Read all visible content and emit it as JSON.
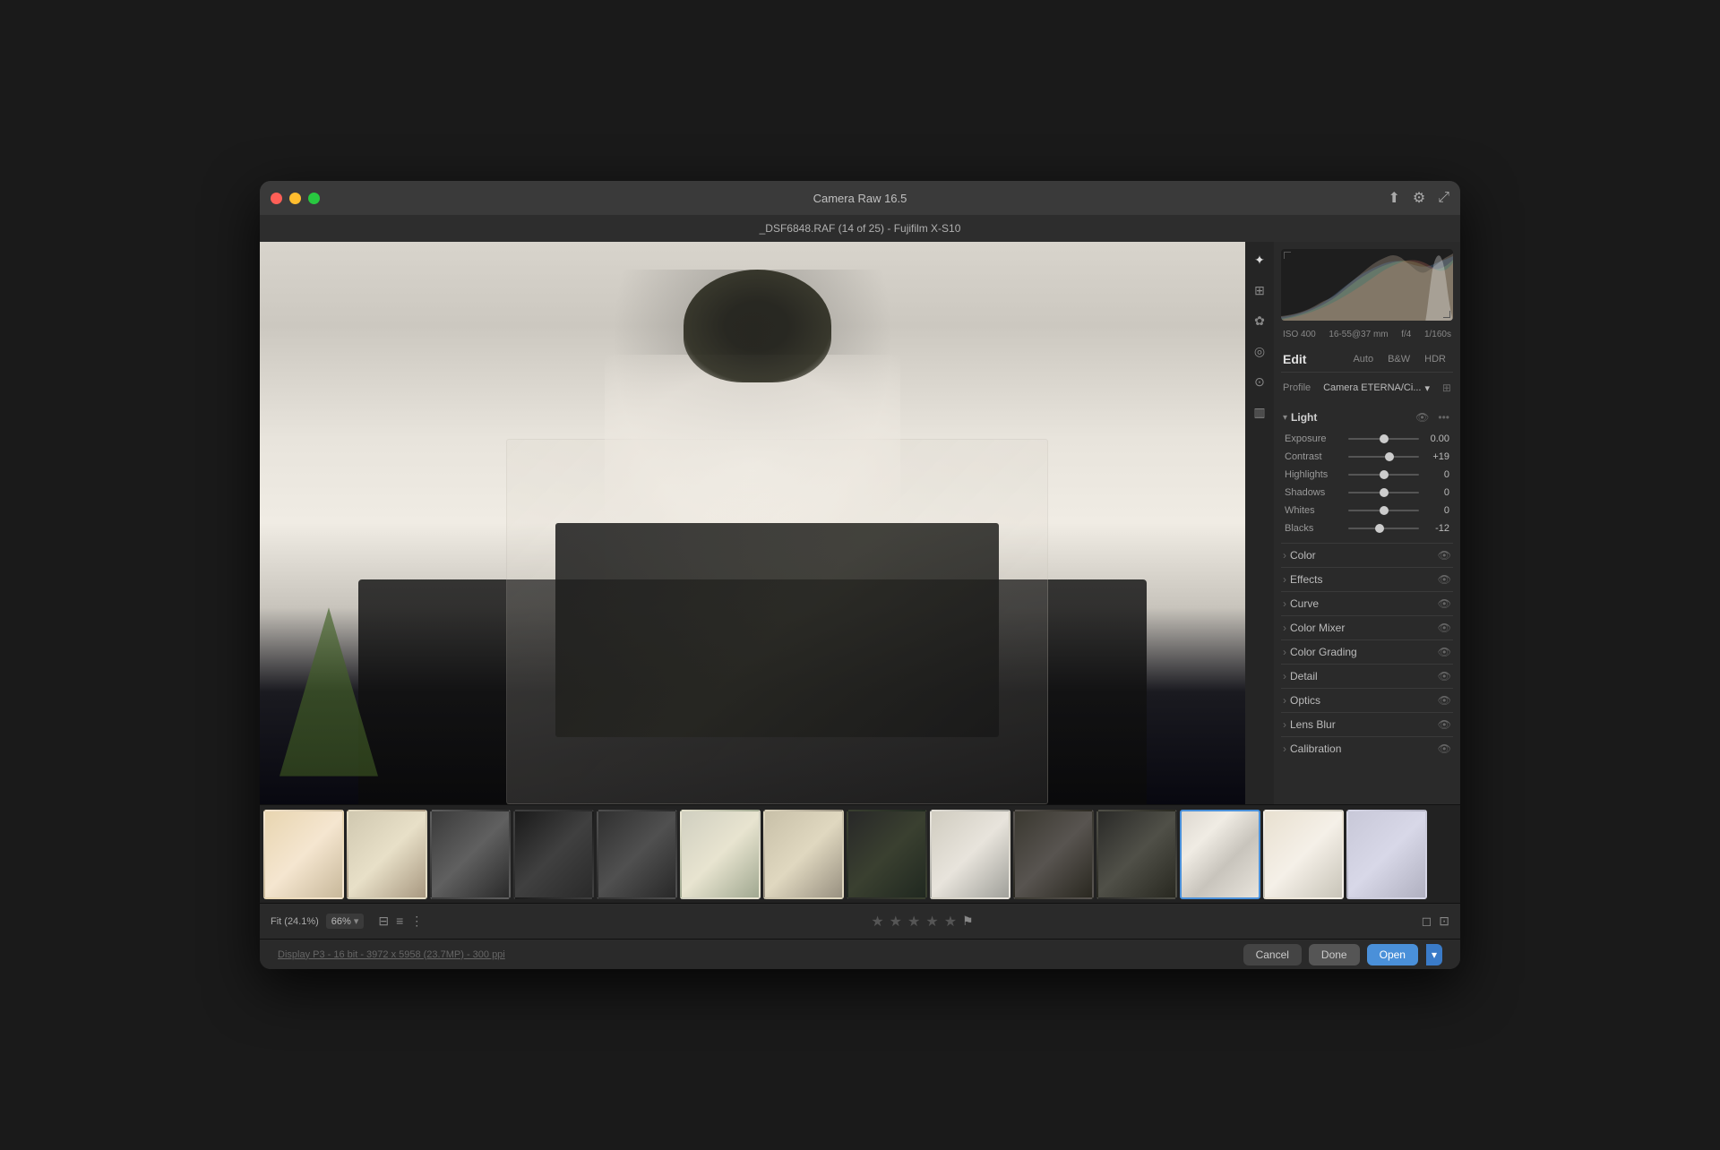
{
  "window": {
    "title": "Camera Raw 16.5",
    "subtitle": "_DSF6848.RAF (14 of 25)  -  Fujifilm X-S10"
  },
  "titlebar": {
    "export_icon": "⬆",
    "settings_icon": "⚙",
    "expand_icon": "⤢"
  },
  "rightpanel": {
    "camera_info": {
      "iso": "ISO 400",
      "focal_length": "16-55@37 mm",
      "aperture": "f/4",
      "shutter": "1/160s"
    },
    "edit": {
      "label": "Edit",
      "auto_btn": "Auto",
      "bw_btn": "B&W",
      "hdr_btn": "HDR"
    },
    "profile": {
      "label": "Profile",
      "value": "Camera ETERNA/Ci..."
    },
    "sections": {
      "light": {
        "label": "Light",
        "expanded": true,
        "sliders": [
          {
            "name": "Exposure",
            "value": "0.00",
            "position": 50
          },
          {
            "name": "Contrast",
            "value": "+19",
            "position": 58
          },
          {
            "name": "Highlights",
            "value": "0",
            "position": 50
          },
          {
            "name": "Shadows",
            "value": "0",
            "position": 50
          },
          {
            "name": "Whites",
            "value": "0",
            "position": 50
          },
          {
            "name": "Blacks",
            "value": "-12",
            "position": 44
          }
        ]
      },
      "color": {
        "label": "Color",
        "expanded": false
      },
      "effects": {
        "label": "Effects",
        "expanded": false
      },
      "curve": {
        "label": "Curve",
        "expanded": false
      },
      "color_mixer": {
        "label": "Color Mixer",
        "expanded": false
      },
      "color_grading": {
        "label": "Color Grading",
        "expanded": false
      },
      "detail": {
        "label": "Detail",
        "expanded": false
      },
      "optics": {
        "label": "Optics",
        "expanded": false
      },
      "lens_blur": {
        "label": "Lens Blur",
        "expanded": false
      },
      "calibration": {
        "label": "Calibration",
        "expanded": false
      }
    }
  },
  "filmstrip": {
    "thumbnails": [
      {
        "id": 1,
        "class": "thumb-1",
        "active": false
      },
      {
        "id": 2,
        "class": "thumb-2",
        "active": false
      },
      {
        "id": 3,
        "class": "thumb-3",
        "active": false
      },
      {
        "id": 4,
        "class": "thumb-4",
        "active": false
      },
      {
        "id": 5,
        "class": "thumb-5",
        "active": false
      },
      {
        "id": 6,
        "class": "thumb-6",
        "active": false
      },
      {
        "id": 7,
        "class": "thumb-7",
        "active": false
      },
      {
        "id": 8,
        "class": "thumb-8",
        "active": false
      },
      {
        "id": 9,
        "class": "thumb-9",
        "active": false
      },
      {
        "id": 10,
        "class": "thumb-10",
        "active": false
      },
      {
        "id": 11,
        "class": "thumb-11",
        "active": false
      },
      {
        "id": 12,
        "class": "thumb-active",
        "active": true
      },
      {
        "id": 13,
        "class": "thumb-13",
        "active": false
      },
      {
        "id": 14,
        "class": "thumb-14",
        "active": false
      }
    ]
  },
  "bottombar": {
    "fit_label": "Fit (24.1%)",
    "zoom_value": "66%",
    "stars": [
      0,
      0,
      0,
      0,
      0
    ],
    "footer_info": "Display P3 - 16 bit - 3972 x 5958 (23.7MP) - 300 ppi"
  },
  "footer": {
    "cancel_btn": "Cancel",
    "done_btn": "Done",
    "open_btn": "Open"
  }
}
